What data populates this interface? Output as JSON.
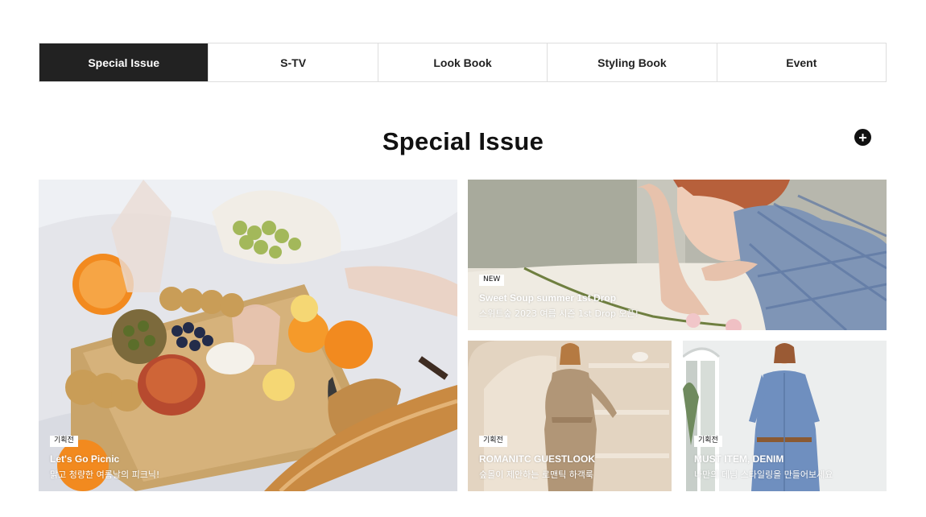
{
  "tabs": [
    {
      "label": "Special Issue",
      "active": true
    },
    {
      "label": "S-TV",
      "active": false
    },
    {
      "label": "Look Book",
      "active": false
    },
    {
      "label": "Styling Book",
      "active": false
    },
    {
      "label": "Event",
      "active": false
    }
  ],
  "section": {
    "title": "Special Issue",
    "more_icon": "plus-circle-icon",
    "more_symbol": "+"
  },
  "cards": [
    {
      "badge": "기획전",
      "title": "Let's Go Picnic",
      "desc": "맑고 청량한 여름날의 피크닉!",
      "image": "picnic-photo"
    },
    {
      "badge": "NEW",
      "title": "Sweet Soup summer 1st Drop",
      "desc": "스위트숲 2023 여름 시즌 1st Drop 오픈!",
      "image": "model-lying-photo"
    },
    {
      "badge": "기획전",
      "title": "ROMANITC GUESTLOOK",
      "desc": "숲몰이 제안하는 로맨틱 하객룩",
      "image": "beige-dress-photo"
    },
    {
      "badge": "기획전",
      "title": "MUST ITEM, DENIM",
      "desc": "나만의 데님 스타일링을 만들어보세요",
      "image": "denim-dress-photo"
    }
  ],
  "colors": {
    "active_tab": "#222222",
    "border": "#dedede",
    "text": "#111111"
  }
}
